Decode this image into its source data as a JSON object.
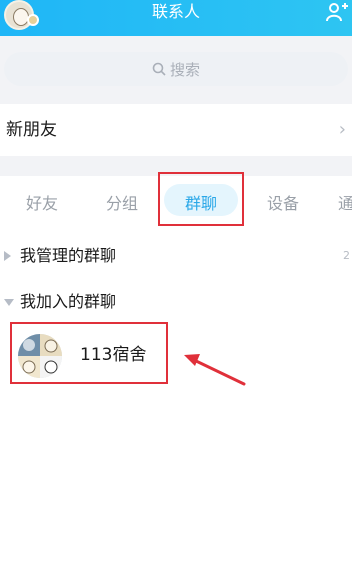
{
  "header": {
    "title": "联系人"
  },
  "search": {
    "placeholder": "搜索"
  },
  "new_friends": {
    "label": "新朋友",
    "chevron": "›"
  },
  "tabs": [
    {
      "label": "好友"
    },
    {
      "label": "分组"
    },
    {
      "label": "群聊",
      "active": true
    },
    {
      "label": "设备"
    },
    {
      "label": "通"
    }
  ],
  "groups": [
    {
      "label": "我管理的群聊",
      "count": "2",
      "expanded": false
    },
    {
      "label": "我加入的群聊",
      "expanded": true
    }
  ],
  "chats": [
    {
      "name": "113宿舍"
    }
  ],
  "colors": {
    "header": "#1fb6f7",
    "active_tab_text": "#2aa8e8",
    "annotation": "#e0303a"
  },
  "icons": {
    "avatar": "avatar",
    "add_contact": "add-contact-icon",
    "search": "search-icon",
    "chevron": "chevron-right-icon",
    "annotation_arrow": "arrow-icon"
  }
}
